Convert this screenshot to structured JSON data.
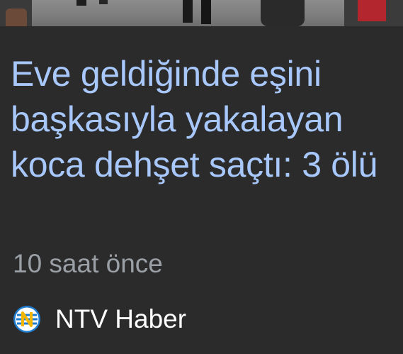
{
  "article": {
    "headline": "Eve geldiğinde eşini başkasıyla yakalayan koca dehşet saçtı: 3 ölü",
    "timestamp": "10 saat önce",
    "source": {
      "name": "NTV Haber",
      "logo_icon": "ntv-logo-icon"
    }
  },
  "colors": {
    "background": "#2b2b2b",
    "headline": "#a8c7fa",
    "timestamp": "#9aa0a6",
    "source": "#ffffff"
  }
}
